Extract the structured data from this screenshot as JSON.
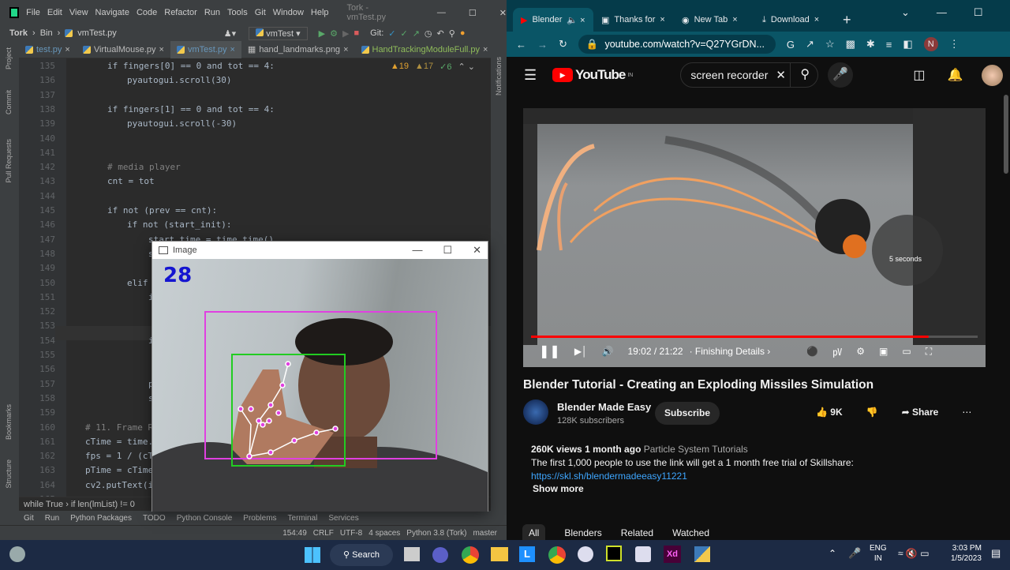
{
  "ide": {
    "menu": [
      "File",
      "Edit",
      "View",
      "Navigate",
      "Code",
      "Refactor",
      "Run",
      "Tools",
      "Git",
      "Window",
      "Help"
    ],
    "window_title": "Tork - vmTest.py",
    "breadcrumb": [
      "Tork",
      "Bin",
      "vmTest.py"
    ],
    "run_config": "vmTest",
    "git_label": "Git:",
    "tabs": [
      "test.py",
      "VirtualMouse.py",
      "vmTest.py",
      "hand_landmarks.png",
      "HandTrackingModuleFull.py"
    ],
    "active_tab": 2,
    "inspections": {
      "warnings": "19",
      "weak": "17",
      "ok": "6"
    },
    "side_left": [
      "Project",
      "Commit",
      "Pull Requests",
      "Bookmarks",
      "Structure"
    ],
    "side_right": [
      "Notifications"
    ],
    "code_lines": [
      {
        "n": "135",
        "i": 136,
        "t": "if fingers[0] == 0 and tot == 4:"
      },
      {
        "n": "136",
        "i": 161,
        "t": "pyautogui.scroll(30)"
      },
      {
        "n": "137",
        "i": 0,
        "t": ""
      },
      {
        "n": "138",
        "i": 136,
        "t": "if fingers[1] == 0 and tot == 4:"
      },
      {
        "n": "139",
        "i": 161,
        "t": "pyautogui.scroll(-30)"
      },
      {
        "n": "140",
        "i": 0,
        "t": ""
      },
      {
        "n": "141",
        "i": 0,
        "t": ""
      },
      {
        "n": "142",
        "i": 136,
        "t": "# media player"
      },
      {
        "n": "143",
        "i": 136,
        "t": "cnt = tot"
      },
      {
        "n": "144",
        "i": 0,
        "t": ""
      },
      {
        "n": "145",
        "i": 136,
        "t": "if not (prev == cnt):"
      },
      {
        "n": "146",
        "i": 161,
        "t": "if not (start_init):"
      },
      {
        "n": "147",
        "i": 188,
        "t": "start_time = time.time()"
      },
      {
        "n": "148",
        "i": 188,
        "t": "s"
      },
      {
        "n": "149",
        "i": 0,
        "t": ""
      },
      {
        "n": "150",
        "i": 161,
        "t": "elif"
      },
      {
        "n": "151",
        "i": 188,
        "t": "i"
      },
      {
        "n": "152",
        "i": 0,
        "t": ""
      },
      {
        "n": "153",
        "i": 0,
        "t": ""
      },
      {
        "n": "154",
        "i": 188,
        "t": "i"
      },
      {
        "n": "155",
        "i": 0,
        "t": ""
      },
      {
        "n": "156",
        "i": 0,
        "t": ""
      },
      {
        "n": "157",
        "i": 188,
        "t": "p"
      },
      {
        "n": "158",
        "i": 188,
        "t": "s"
      },
      {
        "n": "159",
        "i": 0,
        "t": ""
      },
      {
        "n": "160",
        "i": 108,
        "t": "# 11. Frame R"
      },
      {
        "n": "161",
        "i": 108,
        "t": "cTime = time."
      },
      {
        "n": "162",
        "i": 108,
        "t": "fps = 1 / (cT"
      },
      {
        "n": "163",
        "i": 108,
        "t": "pTime = cTime"
      },
      {
        "n": "164",
        "i": 108,
        "t": "cv2.putText(i"
      },
      {
        "n": "165",
        "i": 0,
        "t": ""
      }
    ],
    "code_breadcrumbs": [
      "while True",
      "if len(lmList) != 0"
    ],
    "tool_windows": [
      "Git",
      "Run",
      "Python Packages",
      "TODO",
      "Python Console",
      "Problems",
      "Terminal",
      "Services"
    ],
    "status": [
      "154:49",
      "CRLF",
      "UTF-8",
      "4 spaces",
      "Python 3.8 (Tork)",
      "master"
    ]
  },
  "image_window": {
    "title": "Image",
    "fps_overlay": "28",
    "box_colors": {
      "outer": "#e040e0",
      "inner": "#22cc22"
    }
  },
  "browser": {
    "tabs": [
      "Blender",
      "Thanks for",
      "New Tab",
      "Download"
    ],
    "url": "youtube.com/watch?v=Q27YGrDN...",
    "profile_initial": "N",
    "youtube": {
      "logo": "YouTube",
      "region": "IN",
      "search_value": "screen recorder",
      "player": {
        "time": "19:02 / 21:22",
        "chapter": "Finishing Details",
        "progress": 0.89,
        "overlay": "5 seconds"
      },
      "title": "Blender Tutorial - Creating an Exploding Missiles Simulation",
      "channel": "Blender Made Easy",
      "subscribers": "128K subscribers",
      "subscribe": "Subscribe",
      "likes": "9K",
      "share": "Share",
      "views": "260K views",
      "age": "1 month ago",
      "playlist": "Particle System Tutorials",
      "description": "The first 1,000 people to use the link will get a 1 month free trial of Skillshare:",
      "link": "https://skl.sh/blendermadeeasy11221",
      "show_more": "Show more",
      "chips": [
        "All",
        "Blenders",
        "Related",
        "Watched"
      ]
    }
  },
  "taskbar": {
    "search": "Search",
    "lang": [
      "ENG",
      "IN"
    ],
    "time": "3:03 PM",
    "date": "1/5/2023"
  },
  "colors": {
    "ide_bg": "#2b2b2b",
    "chrome_frame": "#053b4a",
    "yt_red": "#ff0000",
    "taskbar": "#1c2a44"
  }
}
